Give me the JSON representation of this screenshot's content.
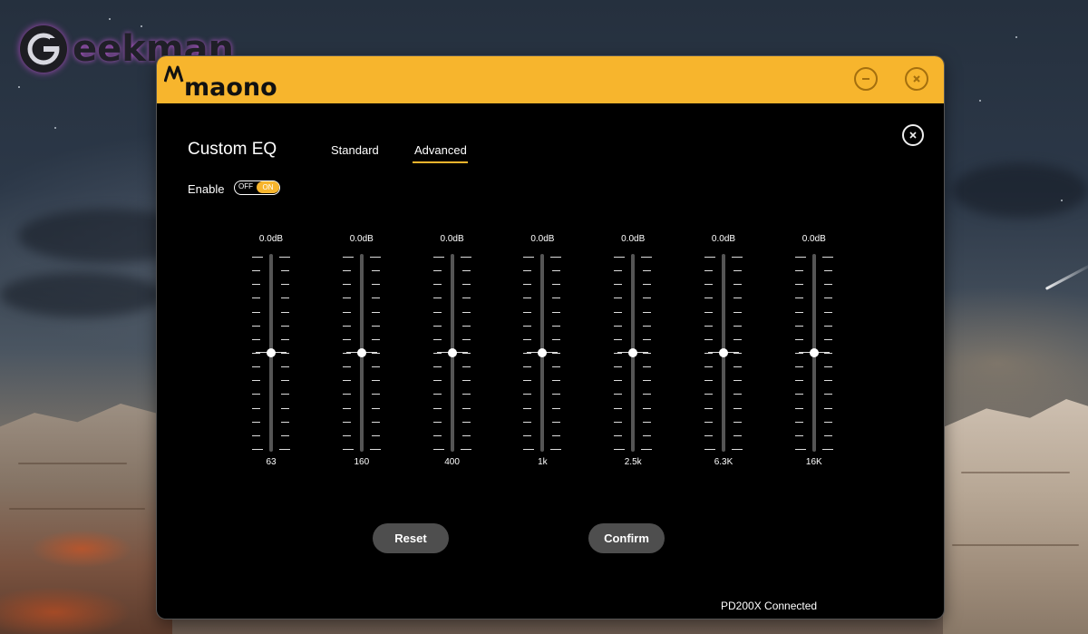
{
  "watermark": {
    "text": "eekman",
    "logo_icon": "geekman-g-icon"
  },
  "app": {
    "brand": "maono",
    "brand_color": "#f7b52d",
    "title": "Custom EQ",
    "tabs": [
      {
        "label": "Standard",
        "active": false
      },
      {
        "label": "Advanced",
        "active": true
      }
    ],
    "enable": {
      "label": "Enable",
      "off_label": "OFF",
      "on_label": "ON",
      "state": "on"
    },
    "bands": [
      {
        "db": "0.0dB",
        "freq": "63",
        "gain": 0
      },
      {
        "db": "0.0dB",
        "freq": "160",
        "gain": 0
      },
      {
        "db": "0.0dB",
        "freq": "400",
        "gain": 0
      },
      {
        "db": "0.0dB",
        "freq": "1k",
        "gain": 0
      },
      {
        "db": "0.0dB",
        "freq": "2.5k",
        "gain": 0
      },
      {
        "db": "0.0dB",
        "freq": "6.3K",
        "gain": 0
      },
      {
        "db": "0.0dB",
        "freq": "16K",
        "gain": 0
      }
    ],
    "buttons": {
      "reset": "Reset",
      "confirm": "Confirm"
    },
    "status": "PD200X Connected",
    "window_controls": [
      "minimize-icon",
      "close-icon"
    ]
  }
}
